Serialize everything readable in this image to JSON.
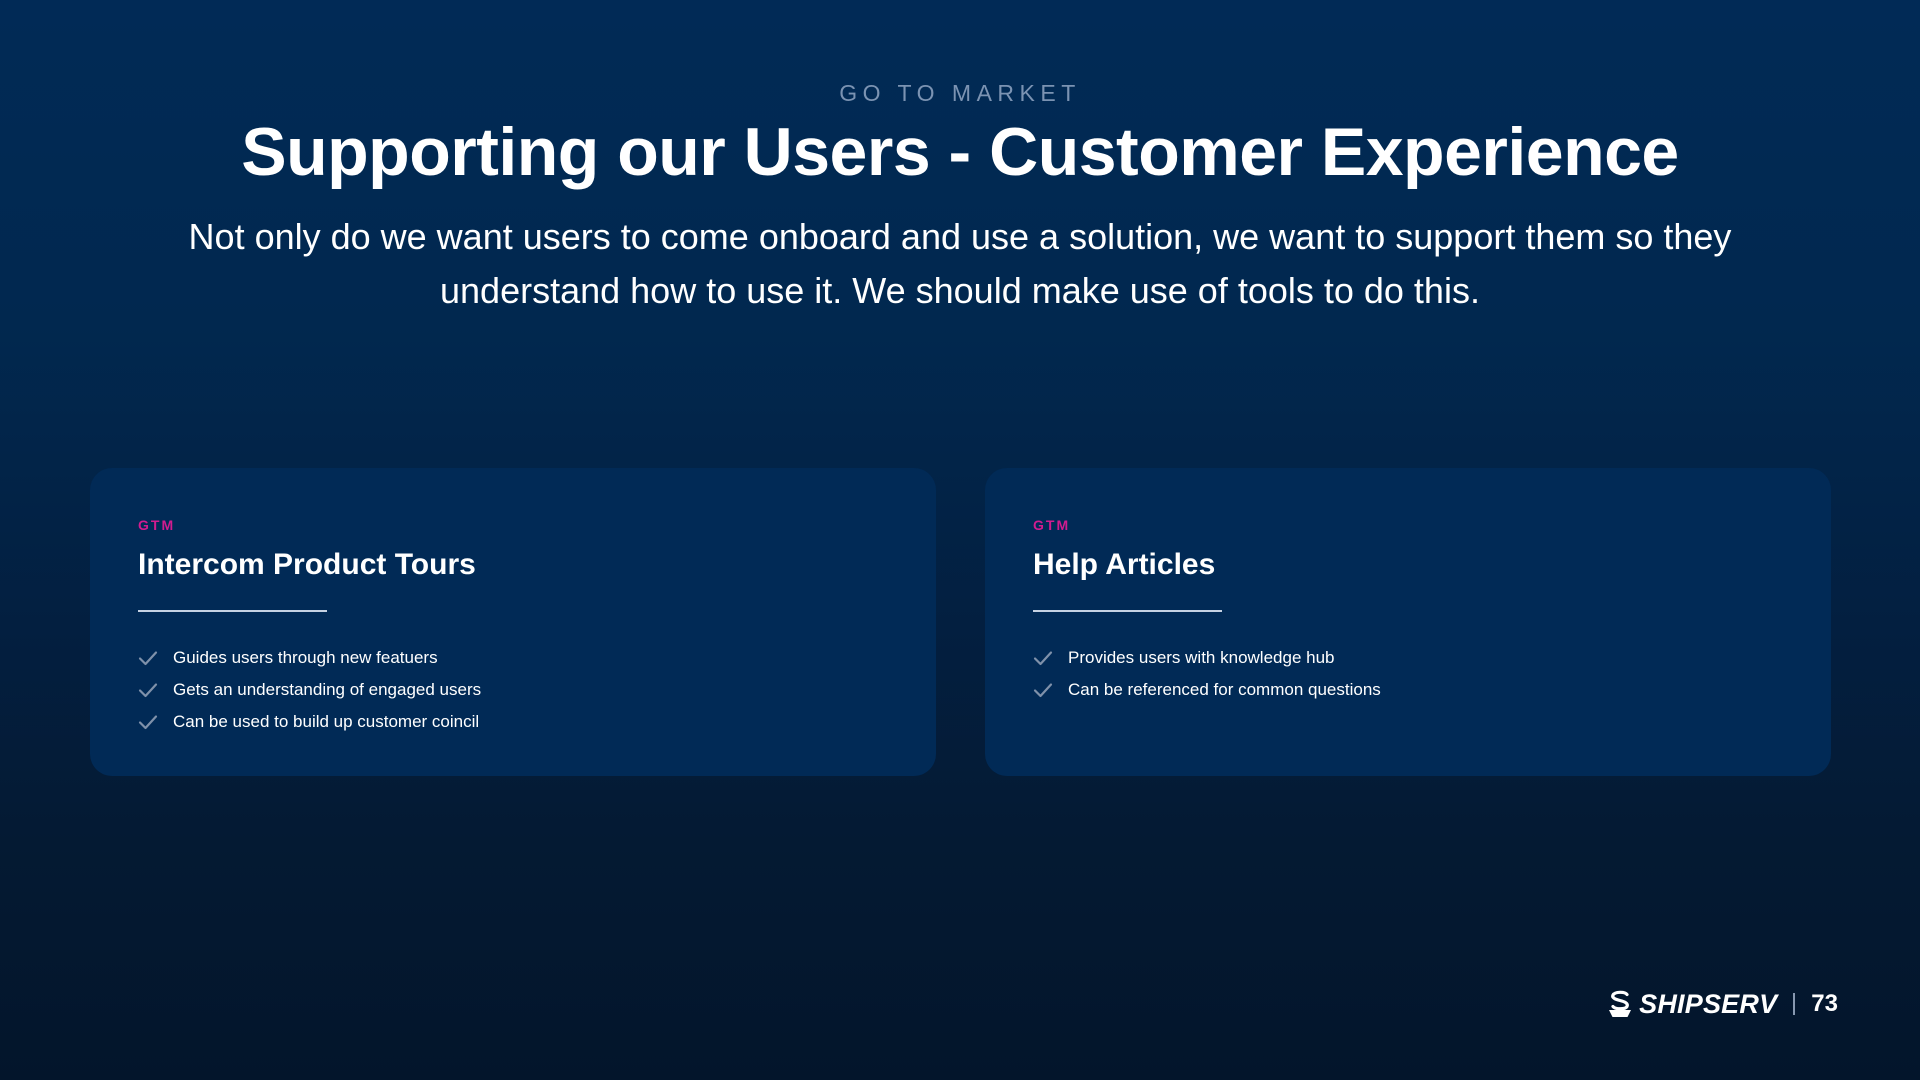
{
  "header": {
    "eyebrow": "GO TO MARKET",
    "title": "Supporting our Users - Customer Experience",
    "subtitle": "Not only do we want users to come onboard and use a solution, we want to support them so they understand how to use it. We should make use of tools to do this."
  },
  "cards": [
    {
      "tag": "GTM",
      "title": "Intercom Product Tours",
      "items": [
        "Guides users through new featuers",
        "Gets an understanding of engaged users",
        "Can be used to build up customer coincil"
      ]
    },
    {
      "tag": "GTM",
      "title": "Help Articles",
      "items": [
        "Provides users with knowledge hub",
        "Can be referenced for common questions"
      ]
    }
  ],
  "footer": {
    "logo_text": "SHIPSERV",
    "page_number": "73"
  },
  "icons": {
    "check": "check-icon",
    "logo": "shipserv-logo-icon"
  },
  "colors": {
    "background": "#012a56",
    "card": "#012a56",
    "accent_tag": "#d21c8f",
    "eyebrow": "#7b93b2",
    "check": "#7f91aa"
  }
}
